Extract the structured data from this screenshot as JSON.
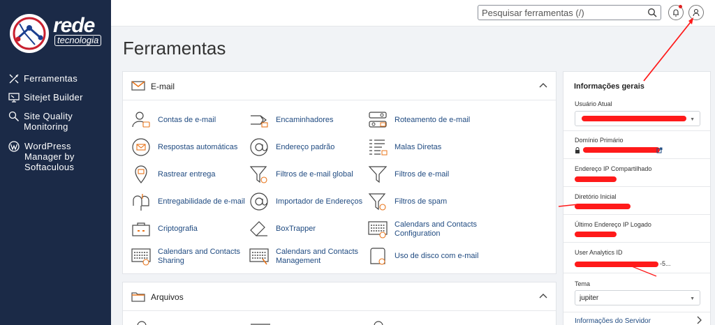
{
  "brand": {
    "line1": "rede",
    "line2": "tecnologia"
  },
  "sidebar": {
    "items": [
      {
        "label": "Ferramentas",
        "icon": "tools-icon"
      },
      {
        "label": "Sitejet Builder",
        "icon": "monitor-icon"
      },
      {
        "label": "Site Quality Monitoring",
        "icon": "magnifier-icon"
      },
      {
        "label": "WordPress Manager by Softaculous",
        "icon": "wordpress-icon"
      }
    ]
  },
  "topbar": {
    "search_placeholder": "Pesquisar ferramentas (/)"
  },
  "page": {
    "title": "Ferramentas"
  },
  "email_section": {
    "title": "E-mail",
    "tools": [
      {
        "label": "Contas de e-mail",
        "icon": "email-accounts-icon"
      },
      {
        "label": "Encaminhadores",
        "icon": "forwarders-icon"
      },
      {
        "label": "Roteamento de e-mail",
        "icon": "email-routing-icon"
      },
      {
        "label": "Respostas automáticas",
        "icon": "autoresponder-icon"
      },
      {
        "label": "Endereço padrão",
        "icon": "default-address-icon"
      },
      {
        "label": "Malas Diretas",
        "icon": "mailing-lists-icon"
      },
      {
        "label": "Rastrear entrega",
        "icon": "track-delivery-icon"
      },
      {
        "label": "Filtros de e-mail global",
        "icon": "global-filter-icon"
      },
      {
        "label": "Filtros de e-mail",
        "icon": "email-filter-icon"
      },
      {
        "label": "Entregabilidade de e-mail",
        "icon": "deliverability-icon"
      },
      {
        "label": "Importador de Endereços",
        "icon": "address-importer-icon"
      },
      {
        "label": "Filtros de spam",
        "icon": "spam-filter-icon"
      },
      {
        "label": "Criptografia",
        "icon": "encryption-icon"
      },
      {
        "label": "BoxTrapper",
        "icon": "boxtrapper-icon"
      },
      {
        "label": "Calendars and Contacts Configuration",
        "icon": "calendar-config-icon"
      },
      {
        "label": "Calendars and Contacts Sharing",
        "icon": "calendar-sharing-icon"
      },
      {
        "label": "Calendars and Contacts Management",
        "icon": "calendar-management-icon"
      },
      {
        "label": "Uso de disco com e-mail",
        "icon": "disk-usage-icon"
      }
    ]
  },
  "files_section": {
    "title": "Arquivos"
  },
  "info_panel": {
    "title": "Informações gerais",
    "current_user_label": "Usuário Atual",
    "primary_domain_label": "Domínio Primário",
    "shared_ip_label": "Endereço IP Compartilhado",
    "home_dir_label": "Diretório Inicial",
    "last_ip_label": "Último Endereço IP Logado",
    "analytics_label": "User Analytics ID",
    "analytics_suffix": "-5...",
    "theme_label": "Tema",
    "theme_value": "jupiter",
    "server_info_label": "Informações do Servidor"
  },
  "colors": {
    "sidebar": "#1b2a47",
    "link": "#1f4a80",
    "accent": "#e8741a",
    "annotation": "#ff1a1a"
  }
}
